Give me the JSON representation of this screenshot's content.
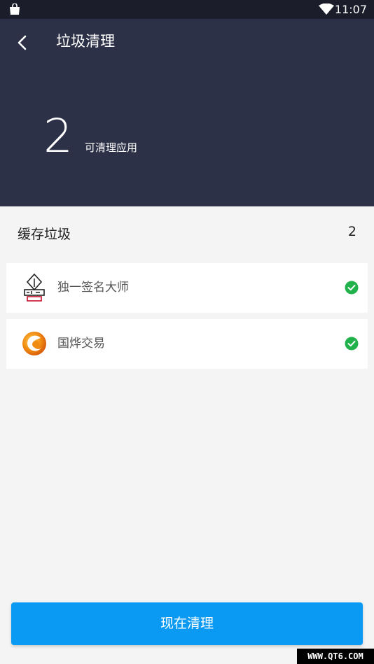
{
  "status_bar": {
    "time": "11:07",
    "icons": [
      "shopping-bag-icon",
      "wifi-icon"
    ]
  },
  "header": {
    "title": "垃圾清理",
    "back_icon": "back-arrow-icon",
    "cleanable_count": "2",
    "cleanable_label": "可清理应用"
  },
  "cache_section": {
    "title": "缓存垃圾",
    "count": "2",
    "items": [
      {
        "name": "独一签名大师",
        "icon": "signature-app-icon",
        "checked": true
      },
      {
        "name": "国烨交易",
        "icon": "trading-app-icon",
        "checked": true
      }
    ]
  },
  "action": {
    "clean_label": "现在清理"
  },
  "watermark": "WWW.QT6.COM",
  "colors": {
    "header_bg": "#2d3147",
    "status_bg": "#1b1d2a",
    "button_bg": "#0a9af3",
    "check_green": "#22b24c",
    "page_bg": "#f4f4f4"
  }
}
